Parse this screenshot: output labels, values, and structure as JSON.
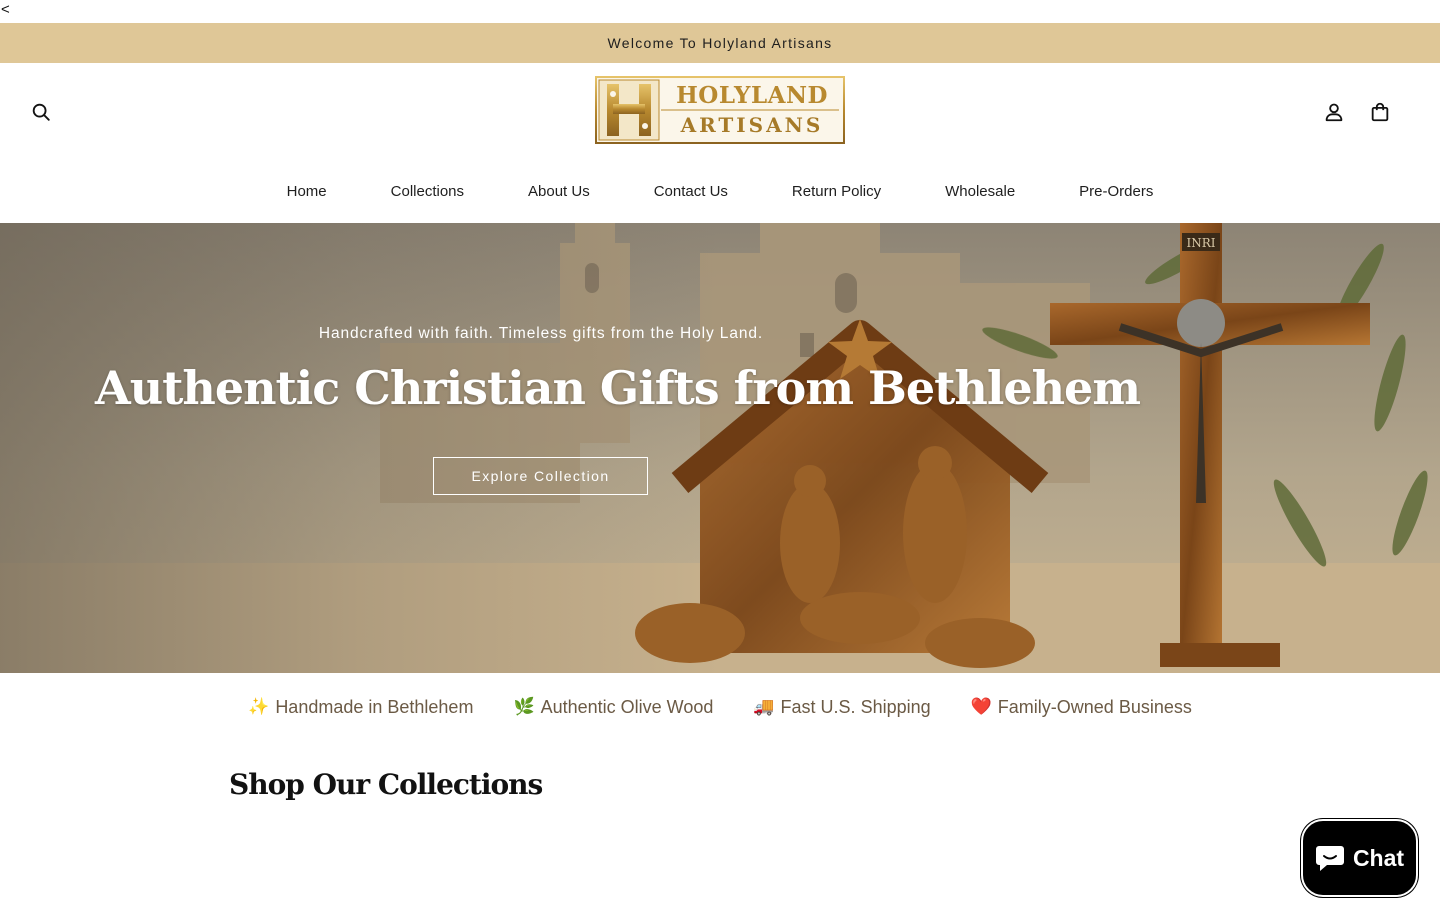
{
  "stray_text": "<",
  "announcement": {
    "text": "Welcome To Holyland Artisans"
  },
  "header": {
    "logo": {
      "line1": "HOLYLAND",
      "line2": "ARTISANS",
      "monogram": "H"
    },
    "icons": {
      "search": "search-icon",
      "account": "account-icon",
      "cart": "bag-icon"
    }
  },
  "nav": {
    "items": [
      "Home",
      "Collections",
      "About Us",
      "Contact Us",
      "Return Policy",
      "Wholesale",
      "Pre-Orders"
    ]
  },
  "hero": {
    "subtitle": "Handcrafted with faith. Timeless gifts from the Holy Land.",
    "title": "Authentic Christian Gifts from Bethlehem",
    "button": "Explore Collection",
    "cross_plaque": "INRI"
  },
  "features": [
    {
      "icon": "✨",
      "label": "Handmade in Bethlehem"
    },
    {
      "icon": "🌿",
      "label": "Authentic Olive Wood"
    },
    {
      "icon": "🚚",
      "label": "Fast U.S. Shipping"
    },
    {
      "icon": "❤️",
      "label": "Family-Owned Business"
    }
  ],
  "section": {
    "title": "Shop Our Collections"
  },
  "chat": {
    "label": "Chat",
    "icon": "chat-bubble-icon"
  },
  "colors": {
    "announcement_bg": "#dfc797",
    "feature_text": "#6b5a45",
    "chat_bg": "#000000",
    "logo_gold": "#b8892f"
  }
}
